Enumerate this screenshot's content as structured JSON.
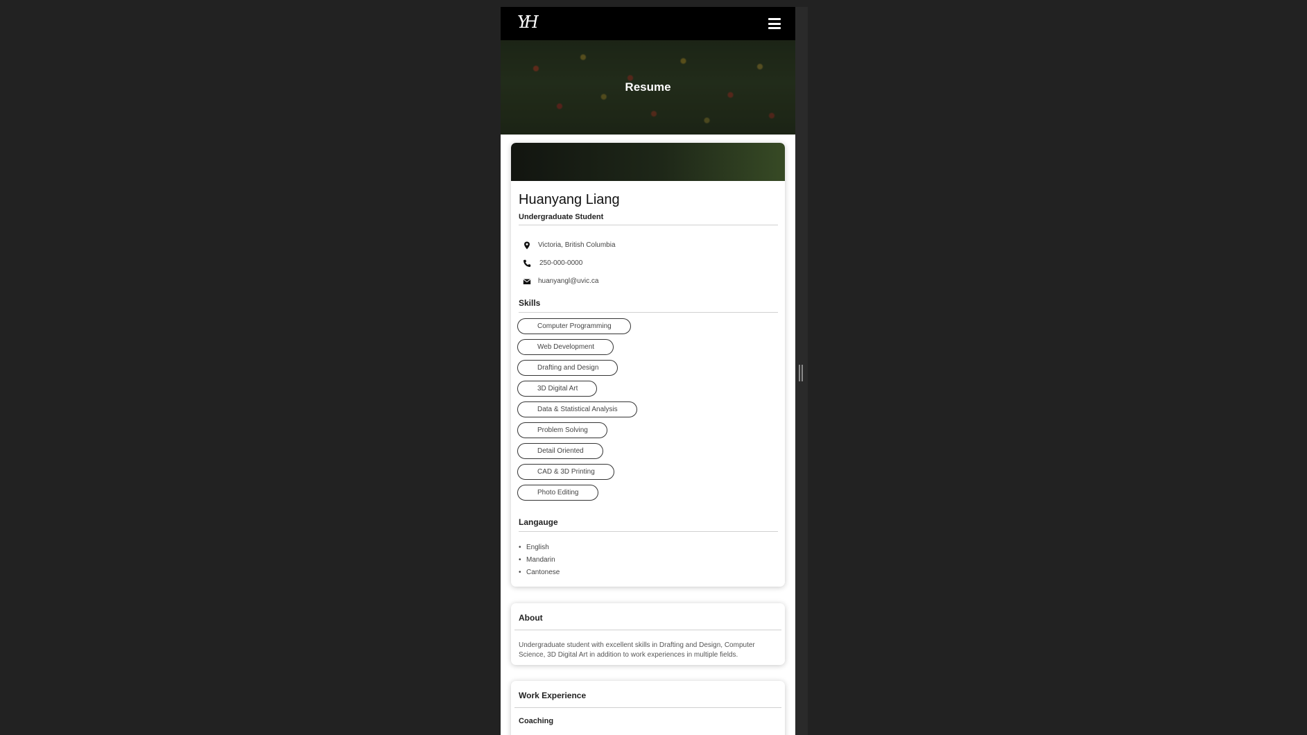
{
  "navbar": {
    "logo_text": "YH",
    "menu_icon": "hamburger-icon"
  },
  "hero": {
    "title": "Resume"
  },
  "profile": {
    "name": "Huanyang Liang",
    "role": "Undergraduate Student",
    "contacts": [
      {
        "icon": "location-pin-icon",
        "text": "Victoria, British Columbia"
      },
      {
        "icon": "phone-icon",
        "text": "250-000-0000"
      },
      {
        "icon": "envelope-icon",
        "text": "huanyangl@uvic.ca"
      }
    ],
    "skills_title": "Skills",
    "skills": [
      "Computer Programming",
      "Web Development",
      "Drafting and Design",
      "3D Digital Art",
      "Data & Statistical Analysis",
      "Problem Solving",
      "Detail Oriented",
      "CAD & 3D Printing",
      "Photo Editing"
    ],
    "language_title": "Langauge",
    "languages": [
      "English",
      "Mandarin",
      "Cantonese"
    ]
  },
  "about": {
    "title": "About",
    "text": "Undergraduate student with excellent skills in Drafting and Design, Computer Science, 3D Digital Art in addition to work experiences in multiple fields."
  },
  "work": {
    "title": "Work Experience",
    "first_job_title": "Coaching"
  },
  "colors": {
    "background": "#222222",
    "navbar": "#000000",
    "card": "#ffffff",
    "banner_accent": "#374a25"
  }
}
